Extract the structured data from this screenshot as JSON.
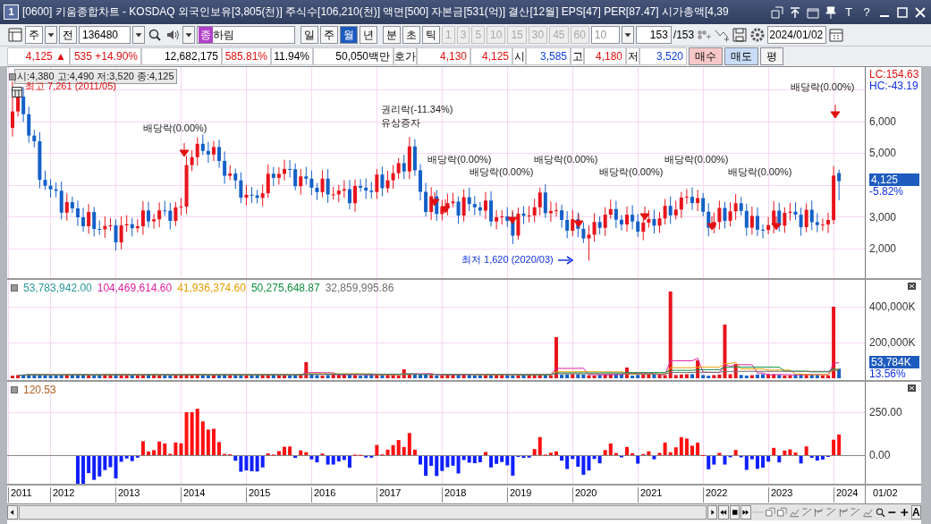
{
  "window": {
    "number": "1",
    "title": "[0600] 키움종합차트 - KOSDAQ 외국인보유[3,805(천)] 주식수[106,210(천)] 액면[500] 자본금[531(억)] 결산[12월] EPS[47] PER[87.47] 시가총액[4,39",
    "text_buttons": [
      "T",
      "?"
    ]
  },
  "toolbar": {
    "unit": "주",
    "prev_button": "전",
    "code": "136480",
    "stock_badge": "종",
    "stock_name": "하림",
    "period_tabs": [
      {
        "label": "일",
        "selected": false
      },
      {
        "label": "주",
        "selected": false
      },
      {
        "label": "월",
        "selected": true
      },
      {
        "label": "년",
        "selected": false
      }
    ],
    "interval_tabs": [
      {
        "label": "분",
        "selected": false
      },
      {
        "label": "초",
        "selected": false
      },
      {
        "label": "틱",
        "selected": false
      }
    ],
    "number_buttons": [
      {
        "label": "1",
        "disabled": true
      },
      {
        "label": "3",
        "disabled": true
      },
      {
        "label": "5",
        "disabled": true
      },
      {
        "label": "10",
        "disabled": true
      },
      {
        "label": "15",
        "disabled": true
      },
      {
        "label": "30",
        "disabled": true
      },
      {
        "label": "45",
        "disabled": true
      },
      {
        "label": "60",
        "disabled": true
      }
    ],
    "interval_value": "10",
    "count": "153",
    "count_total": "/153",
    "date": "2024/01/02"
  },
  "quote": [
    {
      "text": "4,125 ▲",
      "color": "#e01010"
    },
    {
      "text": "535 +14.90%",
      "color": "#e01010"
    },
    {
      "text": "12,682,175",
      "color": "#000000"
    },
    {
      "text": "585.81%",
      "color": "#e01010"
    },
    {
      "text": "11.94%",
      "color": "#000000"
    },
    {
      "text": "50,050백만",
      "color": "#000000"
    },
    {
      "text": "호가"
    },
    {
      "text": "4,130",
      "color": "#e01010"
    },
    {
      "text": "4,125",
      "color": "#e01010"
    },
    {
      "text": "시"
    },
    {
      "text": "3,585",
      "color": "#1040e0"
    },
    {
      "text": "고"
    },
    {
      "text": "4,180",
      "color": "#e01010"
    },
    {
      "text": "저"
    },
    {
      "text": "3,520",
      "color": "#1040e0"
    }
  ],
  "order_buttons": [
    {
      "label": "매수",
      "kind": "buy"
    },
    {
      "label": "매도",
      "kind": "sell"
    },
    {
      "label": "평",
      "kind": "plain"
    }
  ],
  "price_pane": {
    "info": "시:4,380 고:4,490 저:3,520 종:4,125",
    "high_mark": "최고 7,261 (2011/05)",
    "low_mark": "최저 1,620 (2020/03)",
    "events": [
      {
        "label": "배당락(0.00%)",
        "arrow": true
      },
      {
        "label": "권리락(-11.34%)",
        "arrow": true
      },
      {
        "label": "유상증자",
        "arrow": true
      },
      {
        "label": "배당락(0.00%)",
        "arrow": false
      },
      {
        "label": "배당락(0.00%)",
        "arrow": true
      },
      {
        "label": "배당락(0.00%)",
        "arrow": true
      },
      {
        "label": "배당락(0.00%)",
        "arrow": true
      },
      {
        "label": "배당락(0.00%)",
        "arrow": true
      },
      {
        "label": "배당락(0.00%)",
        "arrow": true
      },
      {
        "label": "배당락(0.00%)",
        "arrow": true
      }
    ],
    "lc": "LC:154.63",
    "hc": "HC:-43.19",
    "ticks": [
      "6,000",
      "5,000",
      "3,000",
      "2,000"
    ],
    "current": "4,125",
    "change": "-5.82%"
  },
  "volume_pane": {
    "legend": [
      {
        "text": "53,783,942.00",
        "color": "#2a9a9a"
      },
      {
        "text": "104,469,614.60",
        "color": "#e020a0"
      },
      {
        "text": "41,936,374.60",
        "color": "#e8a000"
      },
      {
        "text": "50,275,648.87",
        "color": "#109040"
      },
      {
        "text": "32,859,995.86",
        "color": "#707070"
      }
    ],
    "ticks": [
      "400,000K",
      "200,000K"
    ],
    "current": "53,784K",
    "ratio": "13.56%"
  },
  "oscillator_pane": {
    "legend": "120.53",
    "ticks": [
      "250.00",
      "0.00"
    ]
  },
  "date_axis": [
    "2011",
    "2012",
    "2013",
    "2014",
    "2015",
    "2016",
    "2017",
    "2018",
    "2019",
    "2020",
    "2021",
    "2022",
    "2023",
    "2024"
  ],
  "date_end": "01/02",
  "scroll_bar": {
    "text_button": "A"
  }
}
